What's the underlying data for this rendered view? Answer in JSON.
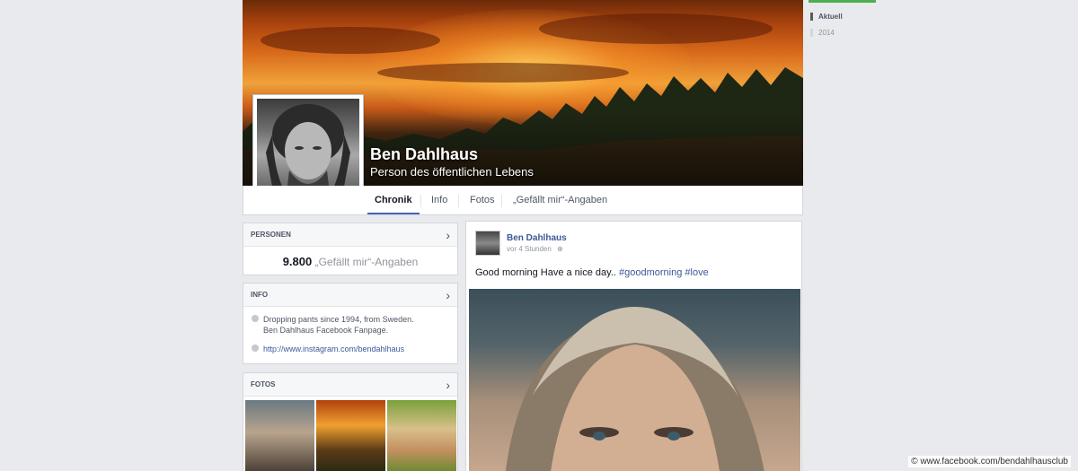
{
  "page": {
    "name": "Ben Dahlhaus",
    "category": "Person des öffentlichen Lebens"
  },
  "tabs": [
    "Chronik",
    "Info",
    "Fotos",
    "„Gefällt mir“-Angaben"
  ],
  "persons_card": {
    "heading": "PERSONEN",
    "likes_count": "9.800",
    "likes_label": "„Gefällt mir“-Angaben"
  },
  "info_card": {
    "heading": "INFO",
    "about_line1": "Dropping pants since 1994, from Sweden.",
    "about_line2": "Ben Dahlhaus Facebook Fanpage.",
    "link": "http://www.instagram.com/bendahlhaus"
  },
  "photos_card": {
    "heading": "FOTOS"
  },
  "post": {
    "author": "Ben Dahlhaus",
    "time": "vor 4 Stunden",
    "text": "Good morning Have a nice day..",
    "hashtag1": "#goodmorning",
    "hashtag2": "#love"
  },
  "timeline": {
    "current": "Aktuell",
    "year": "2014"
  },
  "credit": "© www.facebook.com/bendahlhausclub",
  "icons": {
    "chevron": "chevron-right-icon",
    "globe": "globe-icon"
  }
}
